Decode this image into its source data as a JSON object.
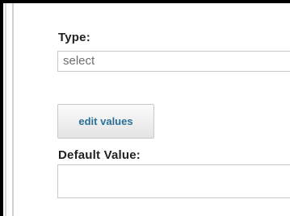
{
  "form": {
    "type_label": "Type:",
    "type_value": "select",
    "edit_values_label": "edit values",
    "default_value_label": "Default Value:",
    "default_value_value": ""
  },
  "colors": {
    "label_text": "#222222",
    "field_border": "#c8c8c8",
    "button_text": "#2a6f98"
  }
}
